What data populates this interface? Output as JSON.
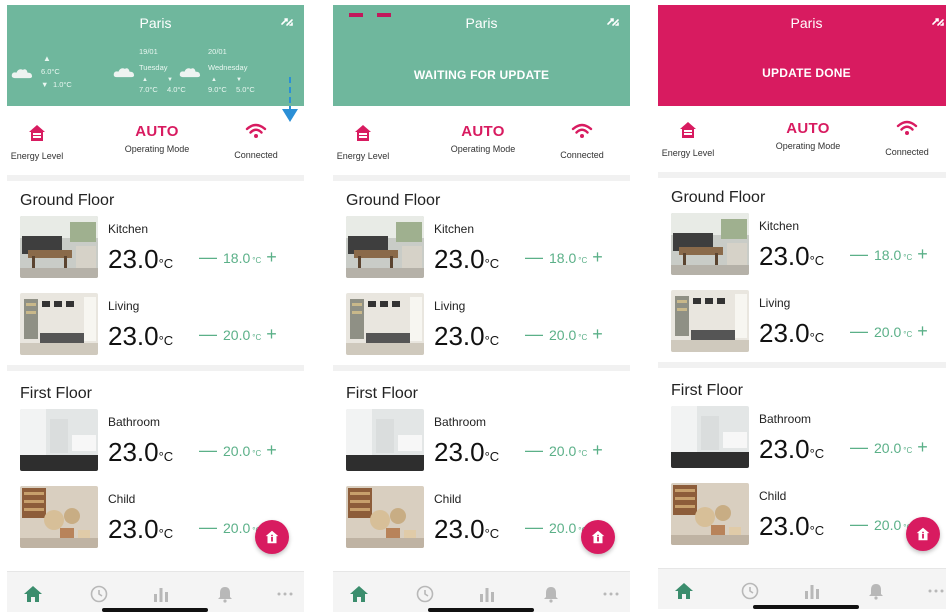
{
  "app": {
    "city": "Paris",
    "status_labels": {
      "energy": "Energy Level",
      "mode": "AUTO",
      "mode_label": "Operating Mode",
      "connection": "Connected"
    }
  },
  "weather": {
    "current": {
      "max": "6.0°C",
      "min": "1.0°C"
    },
    "days": [
      {
        "date": "19/01",
        "day": "Tuesday",
        "max": "7.0°C",
        "min": "4.0°C"
      },
      {
        "date": "20/01",
        "day": "Wednesday",
        "max": "9.0°C",
        "min": "5.0°C"
      }
    ]
  },
  "screens": [
    {
      "state": "weather",
      "message": ""
    },
    {
      "state": "waiting",
      "message": "WAITING FOR UPDATE"
    },
    {
      "state": "done",
      "message": "UPDATE DONE"
    }
  ],
  "floors": [
    {
      "name": "Ground Floor",
      "rooms": [
        {
          "name": "Kitchen",
          "temp": "23.0",
          "unit": "°C",
          "setpoint": "18.0",
          "set_unit": "°C"
        },
        {
          "name": "Living",
          "temp": "23.0",
          "unit": "°C",
          "setpoint": "20.0",
          "set_unit": "°C"
        }
      ]
    },
    {
      "name": "First Floor",
      "rooms": [
        {
          "name": "Bathroom",
          "temp": "23.0",
          "unit": "°C",
          "setpoint": "20.0",
          "set_unit": "°C"
        },
        {
          "name": "Child",
          "temp": "23.0",
          "unit": "°C",
          "setpoint": "20.0",
          "set_unit": "°C"
        }
      ]
    }
  ],
  "controls": {
    "minus": "—",
    "plus": "+"
  },
  "tabs": [
    "home-icon",
    "history-icon",
    "stats-icon",
    "bell-icon",
    "more-icon"
  ],
  "colors": {
    "green_header": "#6fb79d",
    "pink_header": "#d81b60",
    "accent": "#d81b60",
    "setpoint": "#5bb088"
  }
}
